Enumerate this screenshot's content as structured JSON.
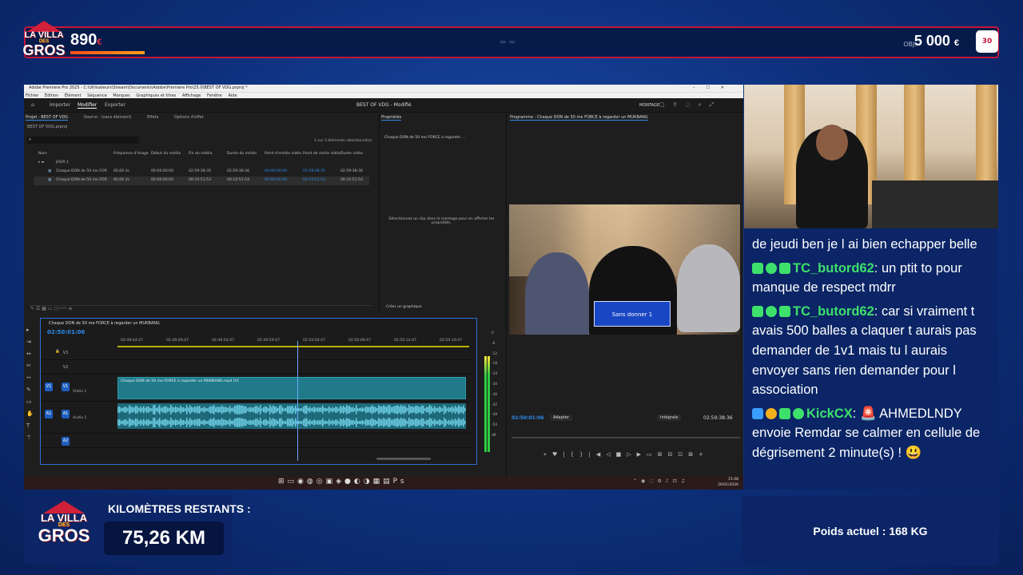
{
  "overlay": {
    "logo_lines": [
      "LA VILLA",
      "DES",
      "GROS"
    ],
    "donation_count": "890",
    "donation_unit": "€",
    "goal_prefix": "OBJ.",
    "goal_value": "5 000",
    "goal_unit": "€",
    "progress_fraction": 0.08,
    "colors": {
      "accent": "#c4163a",
      "background": "#0d2f7a",
      "panel": "#0b2566",
      "chat_user": "#3ee06c"
    },
    "km_label": "KILOMÈTRES RESTANTS :",
    "km_value": "75,26 KM",
    "weight_text": "Poids actuel : 168 KG"
  },
  "premiere": {
    "window_title": "Adobe Premiere Pro 2025 - C:\\Utilisateurs\\Stream\\Documents\\Adobe\\Premiere Pro\\25.0\\BEST OF VDG.prproj *",
    "menu": [
      "Fichier",
      "Édition",
      "Élément",
      "Séquence",
      "Marques",
      "Graphiques et titres",
      "Affichage",
      "Fenêtre",
      "Aide"
    ],
    "tabs": [
      "Importer",
      "Modifier",
      "Exporter"
    ],
    "document_title": "BEST OF VDG - Modifié",
    "workspace": "MONTAGE",
    "project": {
      "tabs": [
        "Projet : BEST OF VDG",
        "Source : (sans élément)",
        "Effets",
        "Options d'effet"
      ],
      "file": "BEST OF VDG.prproj",
      "selection_info": "1 sur 3 éléments sélectionné(s)",
      "columns": [
        "Nom",
        "Fréquence d'image",
        "Début du média",
        "Fin du média",
        "Durée du média",
        "Point d'entrée vidéo",
        "Point de sortie vidéo",
        "Durée vidéo"
      ],
      "rows": [
        [
          "JOUR 1",
          "",
          "",
          "",
          "",
          "",
          "",
          ""
        ],
        [
          "Chaque DON de 50 me FOR",
          "60,00 i/s",
          "00:00:00:00",
          "02:59:38:35",
          "02:59:38:36",
          "00:00:00:00",
          "02:59:38:35",
          "02:59:38:36"
        ],
        [
          "Chaque DON de 50 me FOR",
          "60,00 i/s",
          "00:00:00:00",
          "00:10:51:53",
          "00:10:51:54",
          "00:00:00:00",
          "00:10:51:53",
          "00:10:51:54"
        ]
      ]
    },
    "properties": {
      "title": "Propriétés",
      "item": "Chaque DON de 50 me FORCE à regarder ...",
      "hint": "Sélectionnez un clip dans le montage pour en afficher les propriétés.",
      "create_graphic": "Créer un graphique"
    },
    "program": {
      "title": "Programme : Chaque DON de 50 me FORCE à regarder un MUKBANG",
      "timecode": "02:50:01:06",
      "fit": "Adapter",
      "quality": "Intégrale",
      "duration": "02:59:38:36",
      "banner_text": "Sans donner 1"
    },
    "timeline": {
      "sequence": "Chaque DON de 50 me FORCE à regarder un MUKBANG",
      "timecode": "02:50:01:06",
      "ruler": [
        "02:49:44:47",
        "02:49:49:47",
        "02:49:54:47",
        "02:49:59:47",
        "02:50:04:47",
        "02:50:09:47",
        "02:50:14:47",
        "02:50:19:47"
      ],
      "tracks": [
        "V3",
        "V2",
        "V1",
        "A1",
        "A2"
      ],
      "video_track_label": "Vidéo 1",
      "audio_track_label": "Audio 1",
      "clip_name": "Chaque DON de 50 me FORCE à regarder un MUKBANG.mp4 [V]",
      "meter_labels": [
        "0",
        "-6",
        "-12",
        "-18",
        "-24",
        "-30",
        "-36",
        "-42",
        "-48",
        "-54",
        "dB"
      ]
    },
    "taskbar": {
      "time": "15:48",
      "date": "20/01/2026"
    }
  },
  "chat": [
    {
      "user": "",
      "text": "de jeudi ben je l ai bien echapper belle",
      "badges": []
    },
    {
      "user": "TC_butord62",
      "text": "un ptit to pour manque de respect mdrr",
      "badges": [
        "#3ee06c",
        "#3ee06c",
        "#3ee06c"
      ]
    },
    {
      "user": "TC_butord62",
      "text": "car si vraiment t avais 500 balles a claquer t aurais pas demander de 1v1 mais tu l aurais envoyer sans rien demander pour l association",
      "badges": [
        "#3ee06c",
        "#3ee06c",
        "#3ee06c"
      ]
    },
    {
      "user": "KickCX",
      "text": "🚨 AHMEDLNDY envoie Remdar se calmer en cellule de dégrisement 2 minute(s) ! 😃",
      "badges": [
        "#3b9cff",
        "#f2b11c",
        "#3ee06c",
        "#3ee06c"
      ]
    }
  ]
}
